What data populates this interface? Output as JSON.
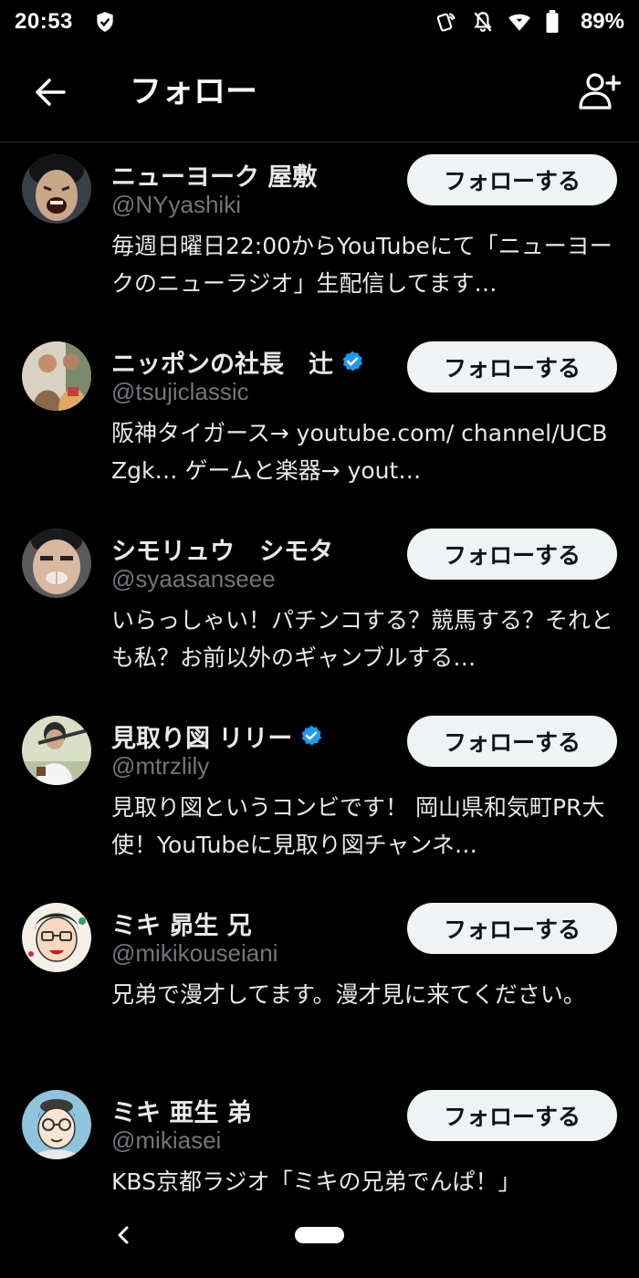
{
  "status_bar": {
    "time": "20:53",
    "battery": "89%",
    "icons": [
      "shield-icon",
      "nfc-icon",
      "notifications-off-icon",
      "wifi-icon",
      "battery-icon"
    ]
  },
  "header": {
    "title": "フォロー",
    "back_icon": "arrow-left-icon",
    "add_user_icon": "add-user-icon"
  },
  "users": [
    {
      "name": "ニューヨーク 屋敷",
      "handle": "@NYyashiki",
      "verified": false,
      "bio": "毎週日曜日22:00からYouTubeにて「ニューヨークのニューラジオ」生配信してます…",
      "button": "フォローする"
    },
    {
      "name": "ニッポンの社長　辻",
      "handle": "@tsujiclassic",
      "verified": true,
      "bio": "阪神タイガース→ youtube.com/ channel/UCBZgk… ゲームと楽器→ yout…",
      "button": "フォローする"
    },
    {
      "name": "シモリュウ　シモタ",
      "handle": "@syaasanseee",
      "verified": false,
      "bio": "いらっしゃい！パチンコする？競馬する？それとも私？お前以外のギャンブルする…",
      "button": "フォローする"
    },
    {
      "name": "見取り図 リリー",
      "handle": "@mtrzlily",
      "verified": true,
      "bio": "見取り図というコンビです！ 岡山県和気町PR大使！YouTubeに見取り図チャンネ…",
      "button": "フォローする"
    },
    {
      "name": "ミキ 昴生 兄",
      "handle": "@mikikouseiani",
      "verified": false,
      "bio": "兄弟で漫才してます。漫才見に来てください。",
      "button": "フォローする"
    },
    {
      "name": "ミキ 亜生 弟",
      "handle": "@mikiasei",
      "verified": false,
      "bio": "KBS京都ラジオ「ミキの兄弟でんぱ！」",
      "button": "フォローする"
    }
  ],
  "nav": {
    "back_icon": "chevron-left-icon",
    "home_icon": "home-pill-icon"
  },
  "colors": {
    "background": "#000000",
    "text_primary": "#e7e9ea",
    "text_secondary": "#71767b",
    "verified": "#1d9bf0",
    "button_bg": "#eff3f4",
    "button_text": "#0f1419"
  }
}
